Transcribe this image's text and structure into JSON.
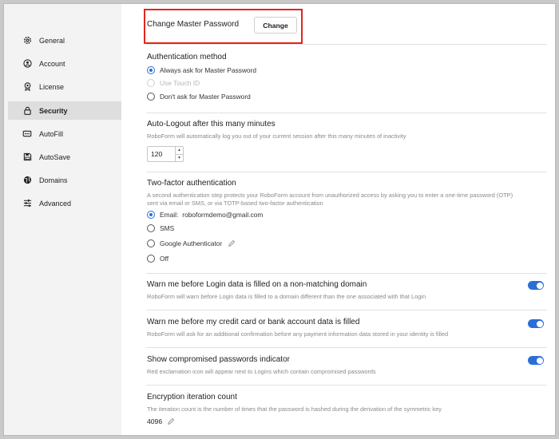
{
  "sidebar": {
    "items": [
      {
        "label": "General",
        "icon": "gear-icon"
      },
      {
        "label": "Account",
        "icon": "user-circle-icon"
      },
      {
        "label": "License",
        "icon": "badge-icon"
      },
      {
        "label": "Security",
        "icon": "lock-icon",
        "active": true
      },
      {
        "label": "AutoFill",
        "icon": "autofill-icon"
      },
      {
        "label": "AutoSave",
        "icon": "save-icon"
      },
      {
        "label": "Domains",
        "icon": "globe-icon"
      },
      {
        "label": "Advanced",
        "icon": "sliders-icon"
      }
    ]
  },
  "master_password": {
    "label": "Change Master Password",
    "button": "Change"
  },
  "auth_method": {
    "title": "Authentication method",
    "options": [
      {
        "label": "Always ask for Master Password",
        "checked": true
      },
      {
        "label": "Use Touch ID",
        "disabled": true
      },
      {
        "label": "Don't ask for Master Password"
      }
    ]
  },
  "auto_logout": {
    "title": "Auto-Logout after this many minutes",
    "desc": "RoboForm will automatically log you out of your current session after this many minutes of inactivity",
    "value": "120"
  },
  "two_factor": {
    "title": "Two-factor authentication",
    "desc1": "A second authentication step protects your RoboForm account from unauthorized access by asking you to enter a one-time password (OTP)",
    "desc2": "sent via email or SMS, or via TOTP-based two-factor authentication",
    "options": [
      {
        "label": "Email:",
        "extra": "roboformdemo@gmail.com",
        "checked": true
      },
      {
        "label": "SMS"
      },
      {
        "label": "Google Authenticator"
      },
      {
        "label": "Off"
      }
    ]
  },
  "warn_domain": {
    "title": "Warn me before Login data is filled on a non-matching domain",
    "desc": "RoboForm will warn before Login data is filled to a domain different than the one associated with that Login",
    "enabled": true
  },
  "warn_card": {
    "title": "Warn me before my credit card or bank account data is filled",
    "desc": "RoboForm will ask for an additional confirmation before any payment information data stored in your identity is filled",
    "enabled": true
  },
  "compromised": {
    "title": "Show compromised passwords indicator",
    "desc": "Red exclamation icon will appear next to Logins which contain compromised passwords",
    "enabled": true
  },
  "encryption": {
    "title": "Encryption iteration count",
    "desc": "The iteration count is the number of times that the password is hashed during the derivation of the symmetric key",
    "value": "4096"
  },
  "colors": {
    "accent": "#2b6fd6",
    "highlight": "#e2261b",
    "sidebar_bg": "#f3f3f3",
    "active_bg": "#dedede"
  }
}
